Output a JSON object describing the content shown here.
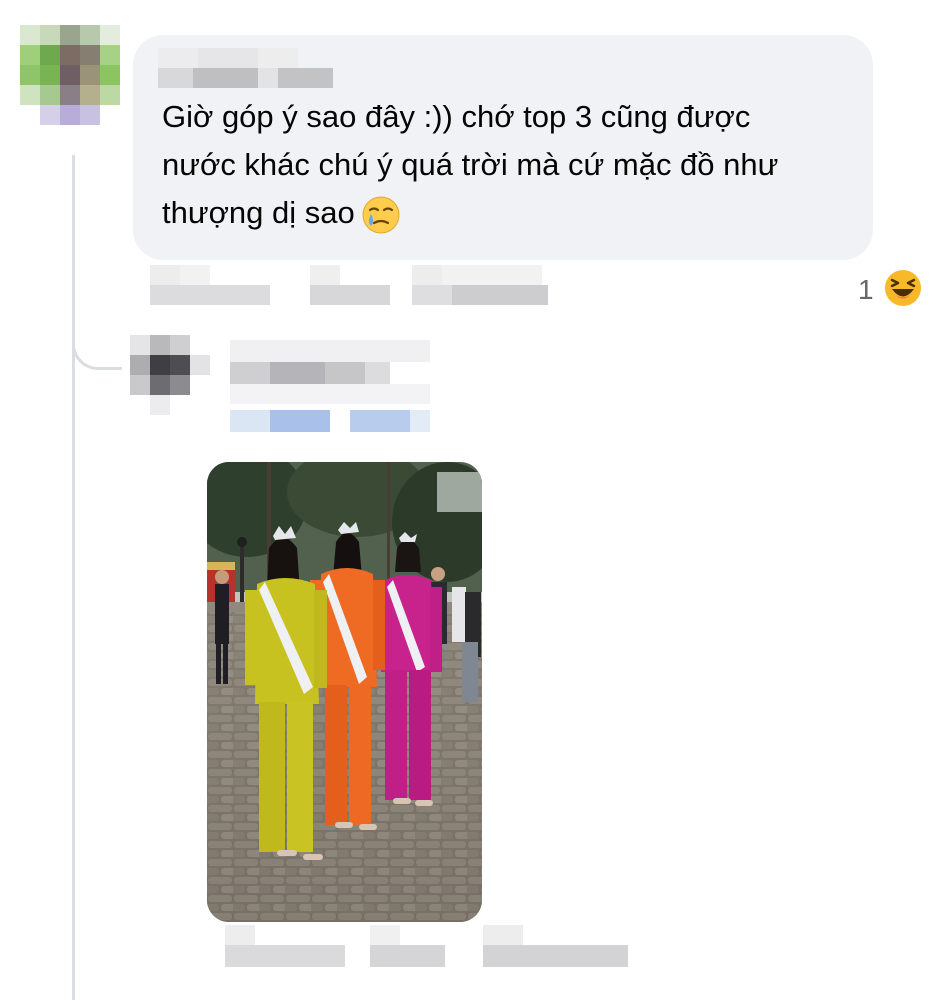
{
  "comment": {
    "lines": [
      "Giờ góp ý sao đây :)) chớ top 3 cũng được",
      "nước khác chú ý quá trời mà cứ mặc đồ như",
      "thượng dị sao"
    ],
    "emoji": "crying-face"
  },
  "reaction": {
    "count": "1",
    "emoji": "laughing-squinting-face"
  },
  "reply": {
    "attachment": "photo"
  },
  "colors": {
    "bubble": "#f0f2f5",
    "text": "#050505",
    "meta": "#65676b",
    "thread_line": "#dadde1"
  }
}
